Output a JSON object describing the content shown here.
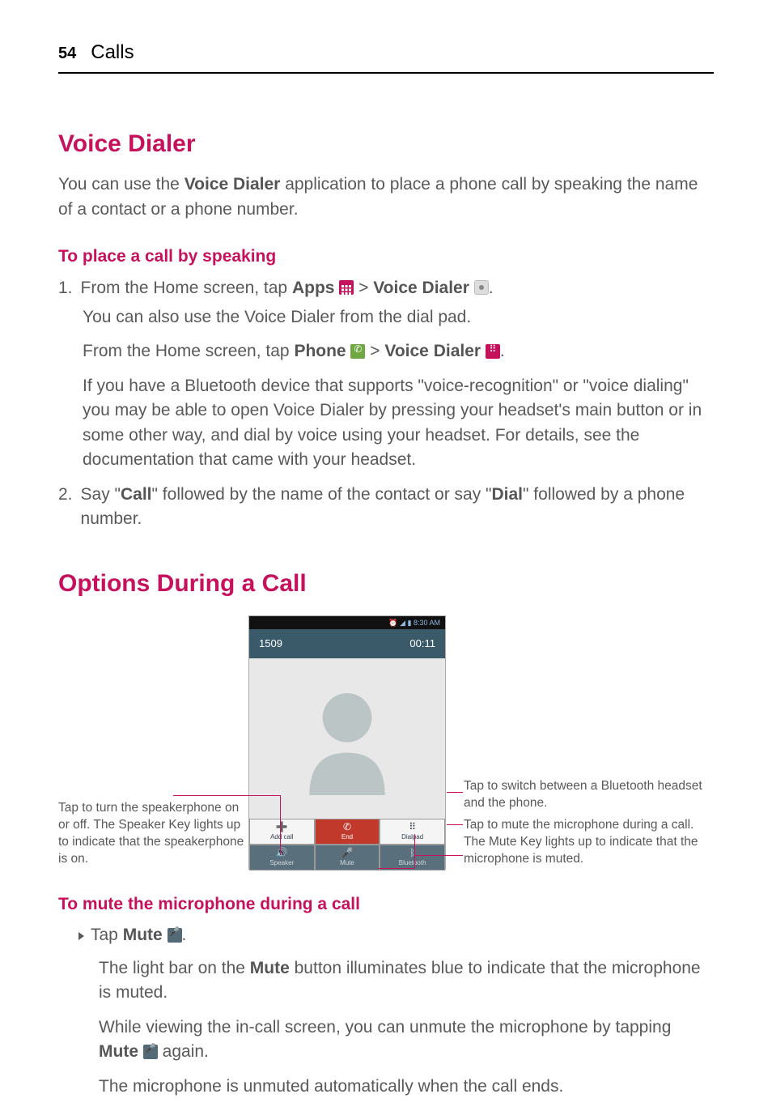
{
  "page": {
    "number": "54",
    "section": "Calls"
  },
  "voiceDialer": {
    "title": "Voice Dialer",
    "intro_pre": "You can use the ",
    "intro_bold": "Voice Dialer",
    "intro_post": " application to place a phone call by speaking the name of a contact or a phone number.",
    "subheading": "To place a call by speaking",
    "step1": {
      "num": "1.",
      "pre": "From the Home screen, tap ",
      "apps": "Apps",
      "mid": " > ",
      "vd": "Voice Dialer",
      "post": ".",
      "line2": "You can also use the Voice Dialer from the dial pad.",
      "line3_pre": "From the Home screen, tap ",
      "line3_phone": "Phone",
      "line3_mid": " > ",
      "line3_vd": "Voice Dialer",
      "line3_post": ".",
      "line4": "If you have a Bluetooth device that supports \"voice-recognition\" or \"voice dialing\" you may be able to open Voice Dialer by pressing your headset's main button or in some other way, and dial by voice using your headset. For details, see the documentation that came with your headset."
    },
    "step2": {
      "num": "2.",
      "pre": "Say \"",
      "call": "Call",
      "mid": "\" followed by the name of the contact or say \"",
      "dial": "Dial",
      "post": "\" followed by a phone number."
    }
  },
  "optionsDuringCall": {
    "title": "Options During a Call",
    "screenshot": {
      "status_time": "8:30 AM",
      "caller": "1509",
      "timer": "00:11",
      "buttons": {
        "addcall": "Add call",
        "end": "End",
        "dialpad": "Dialpad",
        "speaker": "Speaker",
        "mute": "Mute",
        "bluetooth": "Bluetooth"
      }
    },
    "callouts": {
      "speaker": "Tap to turn the speakerphone on or off. The Speaker Key lights up to indicate that the speakerphone is on.",
      "bluetooth": "Tap to switch between a Bluetooth headset and the phone.",
      "mute": "Tap to mute the microphone during a call. The Mute Key lights up to indicate that the microphone is muted."
    },
    "muteSection": {
      "heading": "To mute the microphone during a call",
      "bullet_pre": "Tap ",
      "bullet_bold": "Mute",
      "bullet_post": ".",
      "p1_pre": "The light bar on the ",
      "p1_bold": "Mute",
      "p1_post": " button illuminates blue to indicate that the microphone is muted.",
      "p2_pre": "While viewing the in-call screen, you can unmute the microphone by tapping ",
      "p2_bold": "Mute",
      "p2_post": " again.",
      "p3": "The microphone is unmuted automatically when the call ends."
    }
  }
}
